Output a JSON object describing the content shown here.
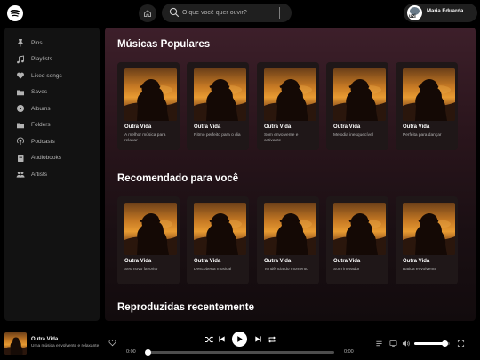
{
  "header": {
    "search_placeholder": "O que você quer ouvir?",
    "user_name": "Maria Eduarda",
    "avatar_text": "uzi"
  },
  "sidebar": {
    "items": [
      {
        "label": "Pins",
        "icon": "pin-icon"
      },
      {
        "label": "Playlists",
        "icon": "music-note-icon"
      },
      {
        "label": "Liked songs",
        "icon": "heart-icon"
      },
      {
        "label": "Saves",
        "icon": "folder-icon"
      },
      {
        "label": "Albums",
        "icon": "disc-icon"
      },
      {
        "label": "Folders",
        "icon": "folder-icon"
      },
      {
        "label": "Podcasts",
        "icon": "podcast-icon"
      },
      {
        "label": "Audiobooks",
        "icon": "book-icon"
      },
      {
        "label": "Artists",
        "icon": "users-icon"
      }
    ]
  },
  "main": {
    "sections": [
      {
        "title": "Músicas Populares",
        "cards": [
          {
            "title": "Outra Vida",
            "subtitle": "A melhor música para relaxar"
          },
          {
            "title": "Outra Vida",
            "subtitle": "Ritmo perfeito para o dia"
          },
          {
            "title": "Outra Vida",
            "subtitle": "Som envolvente e cativante"
          },
          {
            "title": "Outra Vida",
            "subtitle": "Melodia inesquecível"
          },
          {
            "title": "Outra Vida",
            "subtitle": "Perfeita para dançar"
          }
        ]
      },
      {
        "title": "Recomendado para você",
        "cards": [
          {
            "title": "Outra Vida",
            "subtitle": "Seu novo favorito"
          },
          {
            "title": "Outra Vida",
            "subtitle": "Descoberta musical"
          },
          {
            "title": "Outra Vida",
            "subtitle": "Tendência do momento"
          },
          {
            "title": "Outra Vida",
            "subtitle": "Som inovador"
          },
          {
            "title": "Outra Vida",
            "subtitle": "Batida envolvente"
          }
        ]
      },
      {
        "title": "Reproduzidas recentemente",
        "cards": []
      }
    ]
  },
  "player": {
    "title": "Outra Vida",
    "subtitle": "Uma música envolvente e relaxante",
    "elapsed": "0:00",
    "duration": "0:00",
    "progress": 0,
    "volume": 0.85
  },
  "colors": {
    "background": "#000000",
    "sidebar": "#121212",
    "main_gradient_top": "#3d1f2a",
    "card": "#1f1718",
    "text_secondary": "#b3b3b3"
  }
}
